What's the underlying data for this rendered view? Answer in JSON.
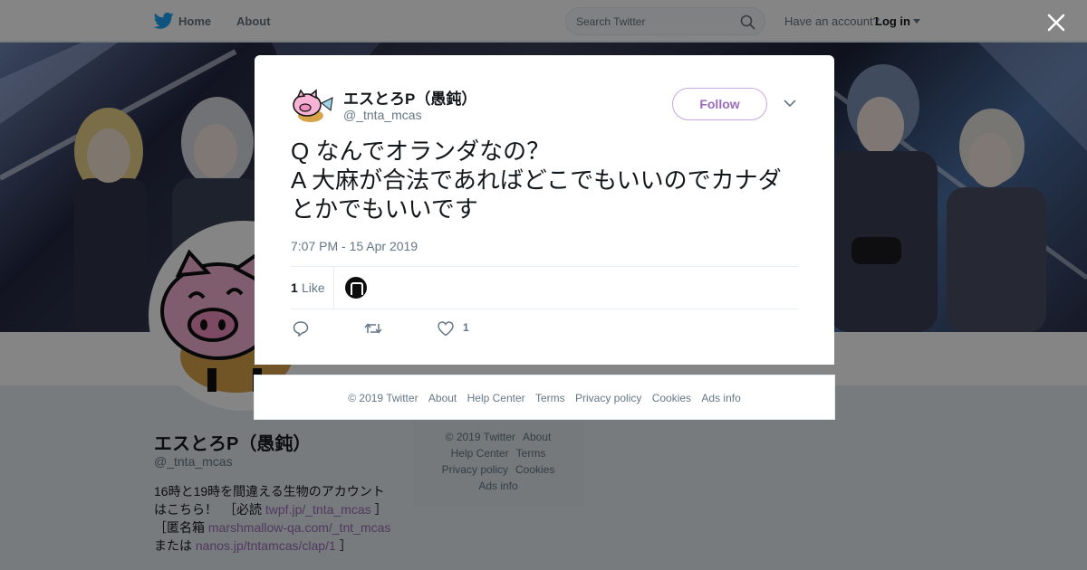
{
  "nav": {
    "home_label": "Home",
    "about_label": "About",
    "search_placeholder": "Search Twitter",
    "have_account": "Have an account?",
    "login_label": "Log in",
    "brand_color": "#1da1f2"
  },
  "profile": {
    "name": "エスとろP（愚鈍）",
    "handle": "@_tnta_mcas",
    "bio_text_1": "16時と19時を間違える生物のアカウントはこちら！　［必読 ",
    "bio_link_1": "twpf.jp/_tnta_mcas",
    "bio_text_2": " ］［匿名箱 ",
    "bio_link_2": "marshmallow-qa.com/_tnt_mcas",
    "bio_text_3": " または ",
    "bio_link_3": "nanos.jp/tntamcas/clap/1",
    "bio_text_4": " ］",
    "link_color": "#9a6bb8"
  },
  "side_footer": {
    "copyright": "© 2019 Twitter",
    "about": "About",
    "help": "Help Center",
    "terms": "Terms",
    "privacy": "Privacy policy",
    "cookies": "Cookies",
    "ads": "Ads info"
  },
  "tweet": {
    "author_name": "エスとろP（愚鈍）",
    "author_handle": "@_tnta_mcas",
    "follow_label": "Follow",
    "text": "Q なんでオランダなの？\nA 大麻が合法であればどこでもいいのでカナダとかでもいいです",
    "timestamp": "7:07 PM - 15 Apr 2019",
    "like_count": "1",
    "like_label": "Like",
    "heart_count": "1"
  },
  "modal_footer": {
    "copyright": "© 2019 Twitter",
    "about": "About",
    "help": "Help Center",
    "terms": "Terms",
    "privacy": "Privacy policy",
    "cookies": "Cookies",
    "ads": "Ads info"
  }
}
